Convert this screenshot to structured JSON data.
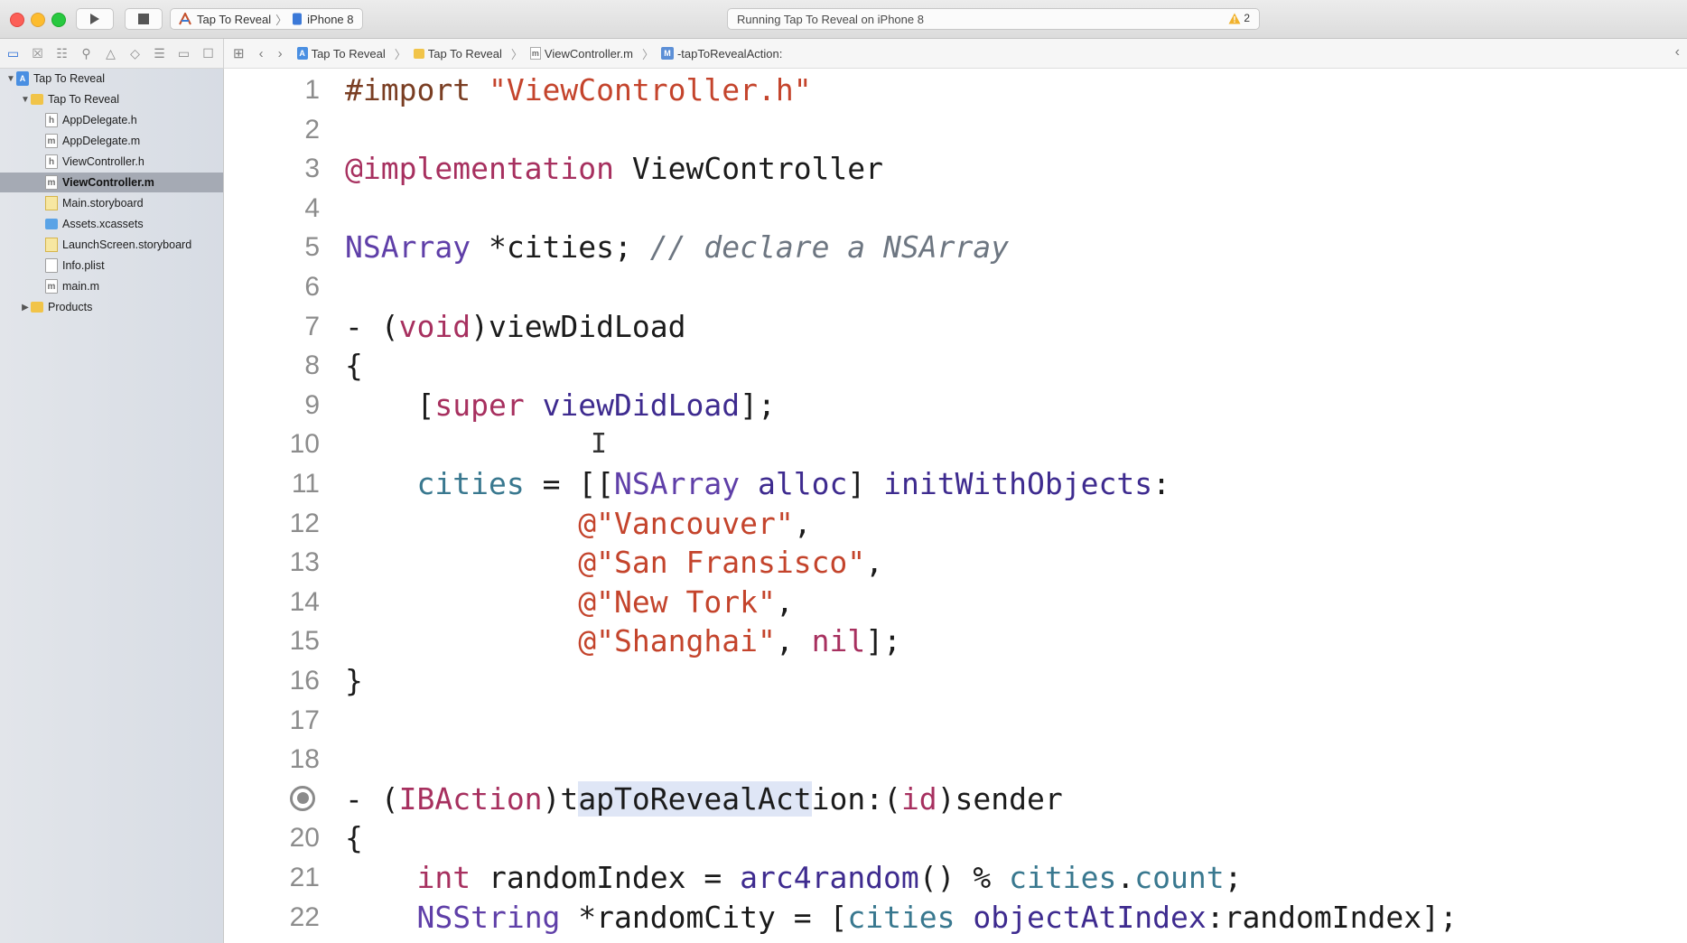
{
  "toolbar": {
    "scheme": "Tap To Reveal",
    "destination": "iPhone 8",
    "activity": "Running Tap To Reveal on iPhone 8",
    "warning_count": "2"
  },
  "navigator": {
    "icons": [
      "folder-icon",
      "source-control-icon",
      "symbol-icon",
      "find-icon",
      "issue-icon",
      "test-icon",
      "debug-icon",
      "breakpoint-icon",
      "report-icon"
    ],
    "items": [
      {
        "label": "Tap To Reveal",
        "type": "proj",
        "glyph": "A",
        "indent": 0,
        "disclosure": "▼",
        "selected": false
      },
      {
        "label": "Tap To Reveal",
        "type": "folder",
        "glyph": "",
        "indent": 1,
        "disclosure": "▼",
        "selected": false
      },
      {
        "label": "AppDelegate.h",
        "type": "doc",
        "glyph": "h",
        "indent": 2,
        "disclosure": "",
        "selected": false
      },
      {
        "label": "AppDelegate.m",
        "type": "doc",
        "glyph": "m",
        "indent": 2,
        "disclosure": "",
        "selected": false
      },
      {
        "label": "ViewController.h",
        "type": "doc",
        "glyph": "h",
        "indent": 2,
        "disclosure": "",
        "selected": false
      },
      {
        "label": "ViewController.m",
        "type": "doc",
        "glyph": "m",
        "indent": 2,
        "disclosure": "",
        "selected": true
      },
      {
        "label": "Main.storyboard",
        "type": "story",
        "glyph": "",
        "indent": 2,
        "disclosure": "",
        "selected": false
      },
      {
        "label": "Assets.xcassets",
        "type": "assets",
        "glyph": "",
        "indent": 2,
        "disclosure": "",
        "selected": false
      },
      {
        "label": "LaunchScreen.storyboard",
        "type": "story",
        "glyph": "",
        "indent": 2,
        "disclosure": "",
        "selected": false
      },
      {
        "label": "Info.plist",
        "type": "doc",
        "glyph": "",
        "indent": 2,
        "disclosure": "",
        "selected": false
      },
      {
        "label": "main.m",
        "type": "doc",
        "glyph": "m",
        "indent": 2,
        "disclosure": "",
        "selected": false
      },
      {
        "label": "Products",
        "type": "folder",
        "glyph": "",
        "indent": 1,
        "disclosure": "▶",
        "selected": false
      }
    ]
  },
  "jumpbar": {
    "crumbs": [
      {
        "label": "Tap To Reveal",
        "icon": "proj",
        "glyph": "A"
      },
      {
        "label": "Tap To Reveal",
        "icon": "folder",
        "glyph": ""
      },
      {
        "label": "ViewController.m",
        "icon": "file",
        "glyph": "m"
      },
      {
        "label": "-tapToRevealAction:",
        "icon": "method",
        "glyph": "M"
      }
    ]
  },
  "editor": {
    "breakpoint_line": 19,
    "lines": [
      [
        [
          "#import ",
          "pre"
        ],
        [
          "\"ViewController.h\"",
          "str"
        ]
      ],
      [],
      [
        [
          "@implementation",
          "kw"
        ],
        [
          " ViewController",
          ""
        ]
      ],
      [],
      [
        [
          "NSArray",
          "ty"
        ],
        [
          " *cities; ",
          ""
        ],
        [
          "// declare a NSArray",
          "cmt"
        ]
      ],
      [],
      [
        [
          "- (",
          ""
        ],
        [
          "void",
          "kw"
        ],
        [
          ")viewDidLoad",
          ""
        ]
      ],
      [
        [
          "{",
          ""
        ]
      ],
      [
        [
          "    [",
          ""
        ],
        [
          "super",
          "kw"
        ],
        [
          " ",
          ""
        ],
        [
          "viewDidLoad",
          "mth"
        ],
        [
          "];",
          ""
        ]
      ],
      [],
      [
        [
          "    ",
          ""
        ],
        [
          "cities",
          "var"
        ],
        [
          " = [[",
          ""
        ],
        [
          "NSArray",
          "ty"
        ],
        [
          " ",
          ""
        ],
        [
          "alloc",
          "mth"
        ],
        [
          "] ",
          ""
        ],
        [
          "initWithObjects",
          "mth"
        ],
        [
          ":",
          ""
        ]
      ],
      [
        [
          "             ",
          ""
        ],
        [
          "@\"Vancouver\"",
          "str"
        ],
        [
          ",",
          ""
        ]
      ],
      [
        [
          "             ",
          ""
        ],
        [
          "@\"San Fransisco\"",
          "str"
        ],
        [
          ",",
          ""
        ]
      ],
      [
        [
          "             ",
          ""
        ],
        [
          "@\"New Tork\"",
          "str"
        ],
        [
          ",",
          ""
        ]
      ],
      [
        [
          "             ",
          ""
        ],
        [
          "@\"Shanghai\"",
          "str"
        ],
        [
          ", ",
          ""
        ],
        [
          "nil",
          "kw"
        ],
        [
          "];",
          ""
        ]
      ],
      [
        [
          "}",
          ""
        ]
      ],
      [],
      [],
      [
        [
          "- (",
          ""
        ],
        [
          "IBAction",
          "kw"
        ],
        [
          ")t",
          ""
        ],
        [
          "apToRevealAct",
          "hl"
        ],
        [
          "ion:(",
          ""
        ],
        [
          "id",
          "kw"
        ],
        [
          ")sender",
          ""
        ]
      ],
      [
        [
          "{",
          ""
        ]
      ],
      [
        [
          "    ",
          ""
        ],
        [
          "int",
          "kw"
        ],
        [
          " randomIndex = ",
          ""
        ],
        [
          "arc4random",
          "mth"
        ],
        [
          "() % ",
          ""
        ],
        [
          "cities",
          "var"
        ],
        [
          ".",
          ""
        ],
        [
          "count",
          "var"
        ],
        [
          ";",
          ""
        ]
      ],
      [
        [
          "    ",
          ""
        ],
        [
          "NSString",
          "ty"
        ],
        [
          " *randomCity = [",
          ""
        ],
        [
          "cities",
          "var"
        ],
        [
          " ",
          ""
        ],
        [
          "objectAtIndex",
          "mth"
        ],
        [
          ":randomIndex];",
          ""
        ]
      ]
    ]
  }
}
